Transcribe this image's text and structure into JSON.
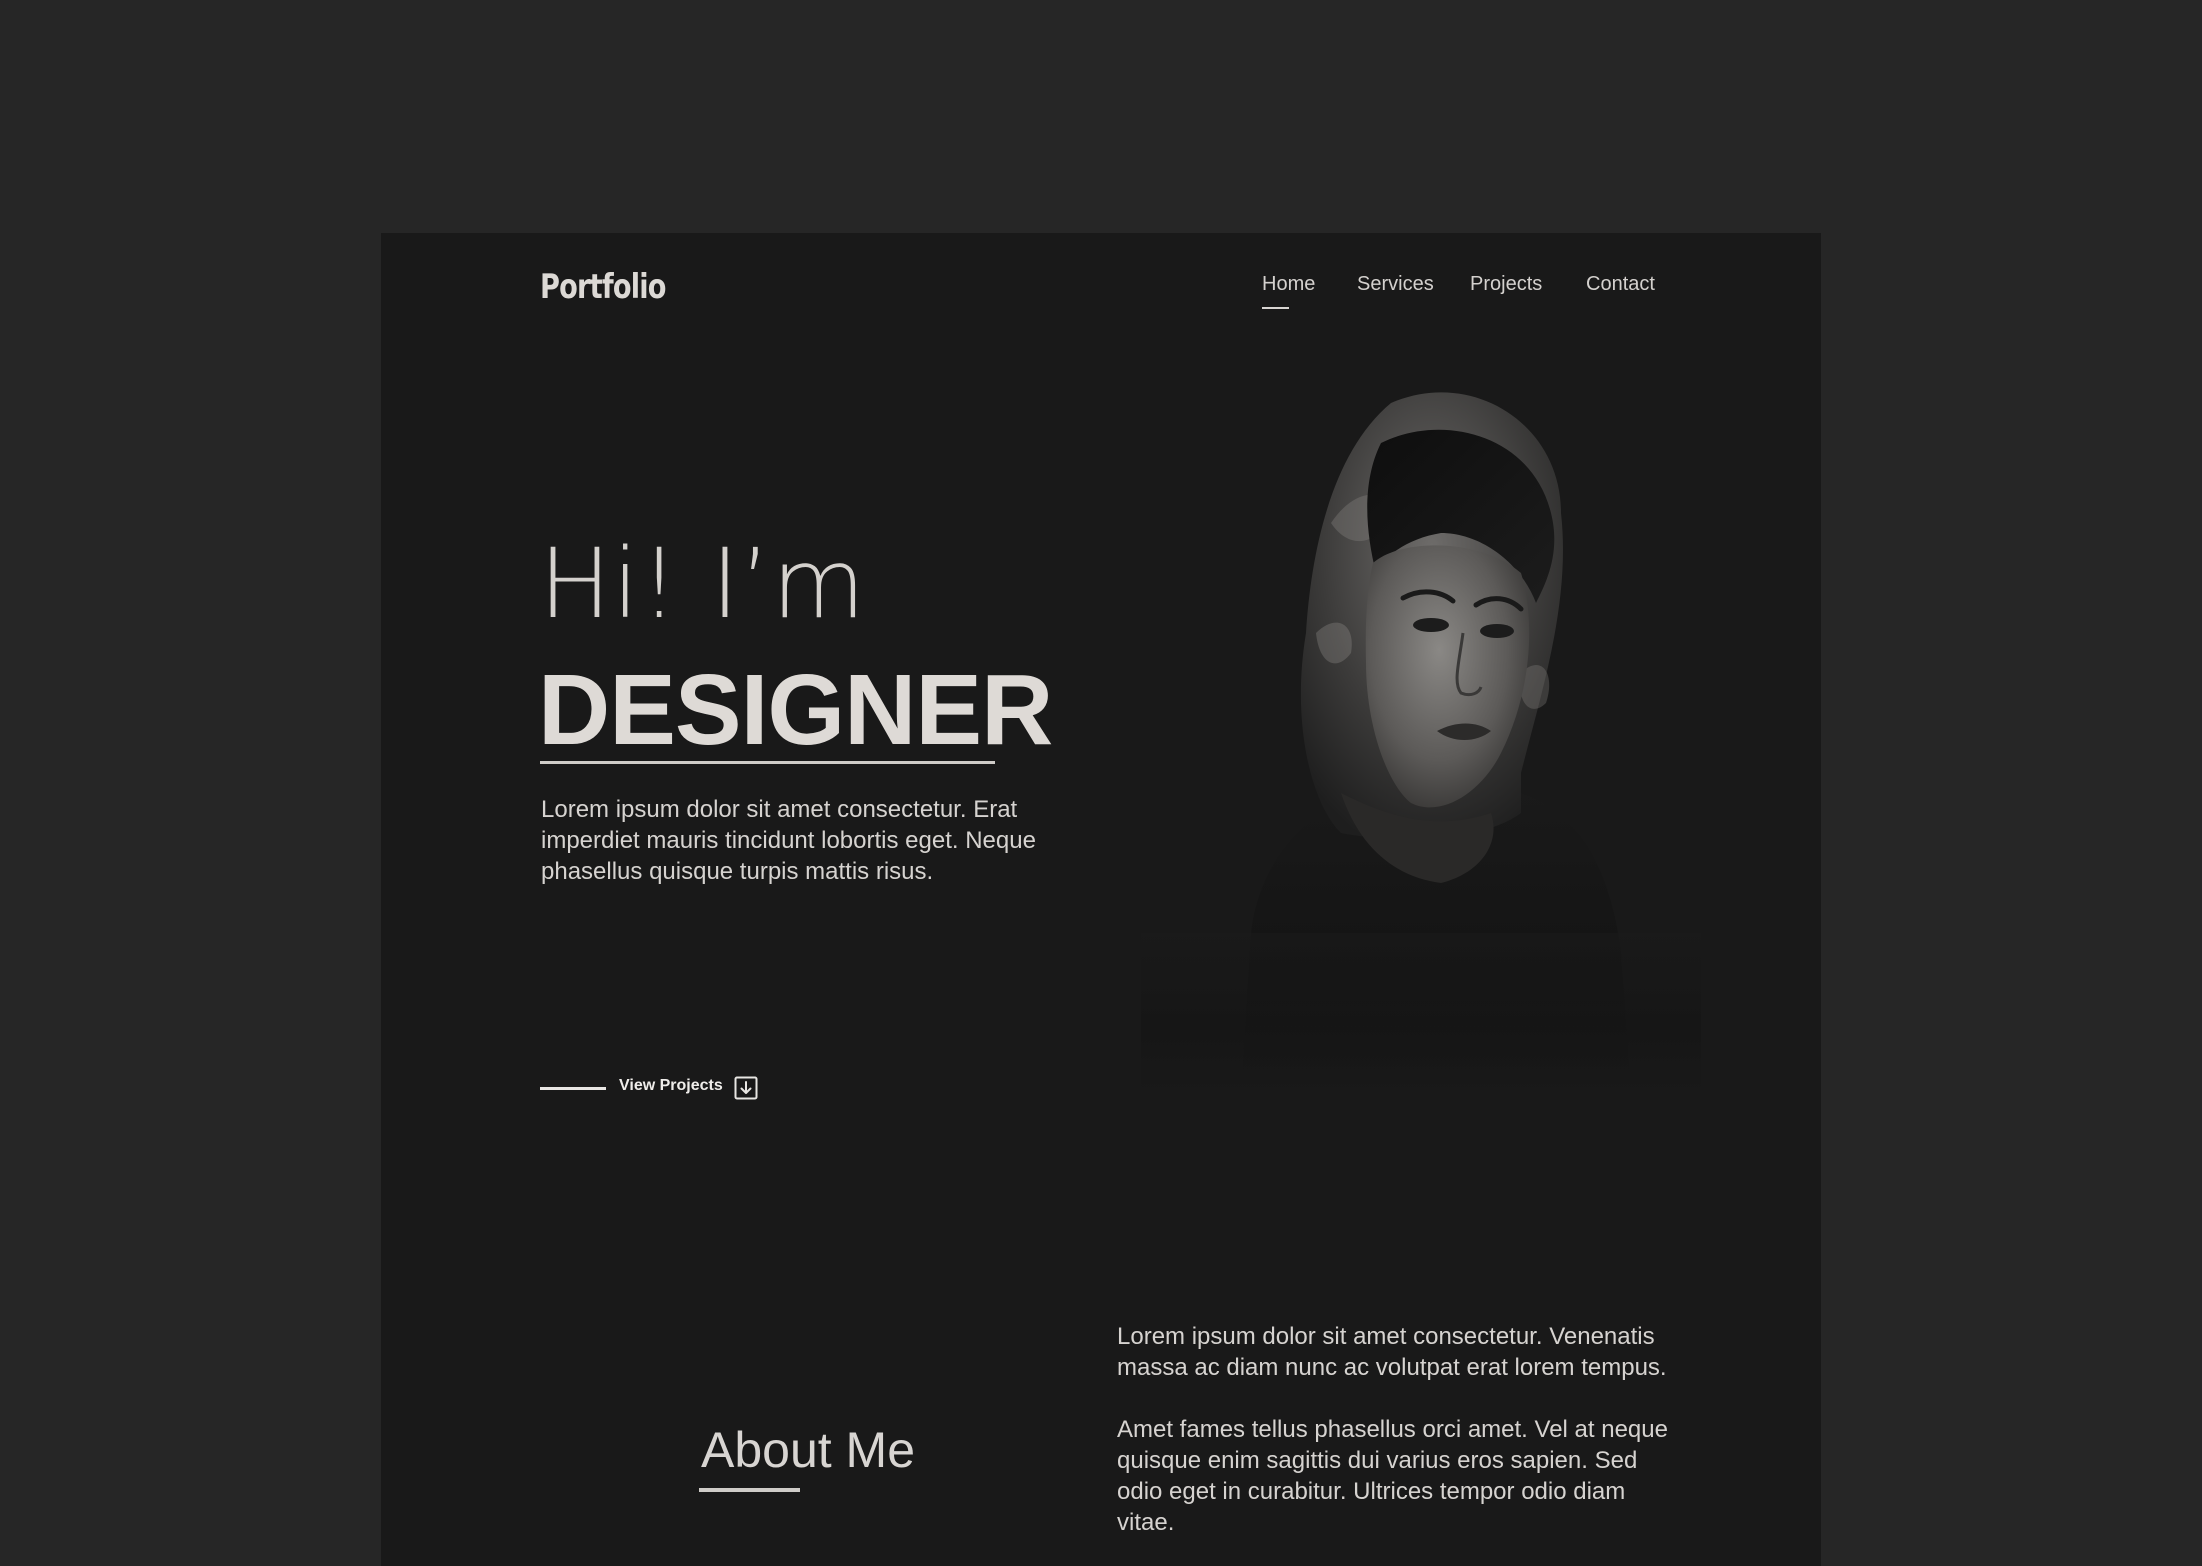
{
  "header": {
    "logo": "Portfolio",
    "nav": [
      {
        "label": "Home"
      },
      {
        "label": "Services"
      },
      {
        "label": "Projects"
      },
      {
        "label": "Contact"
      }
    ],
    "active_nav": "Home"
  },
  "hero": {
    "greeting": "Hi! I’m",
    "title": "DESIGNER",
    "description": "Lorem ipsum dolor sit amet consectetur. Erat imperdiet mauris tincidunt lobortis eget. Neque phasellus quisque turpis mattis risus.",
    "cta_label": "View Projects",
    "cta_icon": "download-arrow-icon",
    "portrait": "portrait-image"
  },
  "about": {
    "title": "About Me",
    "paragraphs": [
      "Lorem ipsum dolor sit amet consectetur. Venenatis massa ac diam nunc ac volutpat erat lorem tempus.",
      "Amet fames tellus phasellus orci amet. Vel at neque quisque enim sagittis dui varius eros sapien. Sed odio eget in curabitur. Ultrices tempor odio diam vitae."
    ]
  },
  "colors": {
    "outer_background": "#262626",
    "page_background": "#191919",
    "text": "#d9d6d3"
  }
}
